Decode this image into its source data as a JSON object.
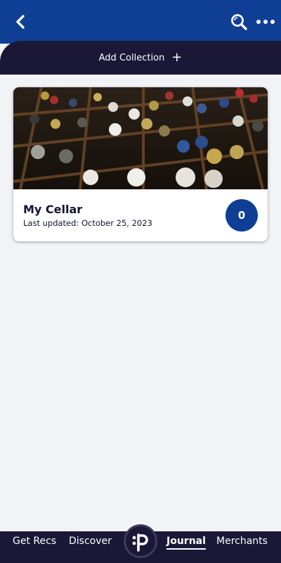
{
  "header": {
    "back_icon": "chevron-left-icon",
    "search_icon": "search-icon",
    "more_icon": "more-horizontal-icon",
    "brand_color": "#0e3f94"
  },
  "subheader": {
    "add_collection_label": "Add Collection",
    "add_icon": "plus-icon",
    "add_symbol": "+",
    "background_color": "#1a1737"
  },
  "collections": [
    {
      "title": "My Cellar",
      "last_updated": "Last updated: October 25, 2023",
      "count": "0",
      "image": "wine-bottles-image"
    }
  ],
  "bottom_nav": {
    "items": [
      {
        "label": "Get Recs",
        "active": false
      },
      {
        "label": "Discover",
        "active": false
      },
      {
        "label": "Journal",
        "active": true
      },
      {
        "label": "Merchants",
        "active": false
      }
    ],
    "logo_icon": "p-logo-icon"
  }
}
